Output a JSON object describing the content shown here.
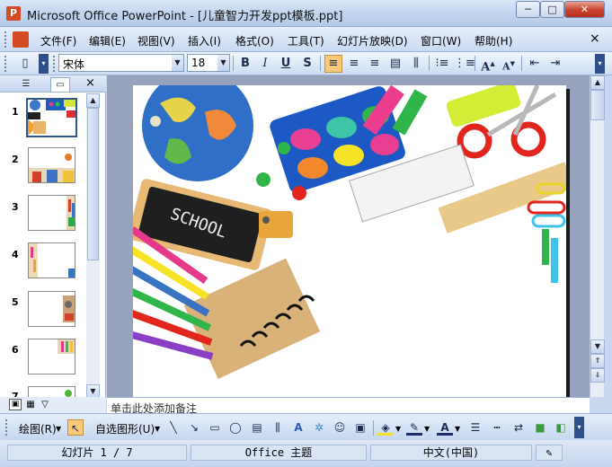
{
  "window": {
    "title": "Microsoft Office PowerPoint - [儿童智力开发ppt模板.ppt]",
    "app_icon_letter": "P",
    "buttons": {
      "minimize": "─",
      "maximize": "□",
      "close": "✕"
    }
  },
  "menu": {
    "items": [
      "文件(F)",
      "编辑(E)",
      "视图(V)",
      "插入(I)",
      "格式(O)",
      "工具(T)",
      "幻灯片放映(D)",
      "窗口(W)",
      "帮助(H)"
    ],
    "close_doc": "×"
  },
  "format_toolbar": {
    "font_name": "宋体",
    "font_size": "18",
    "bold": "B",
    "italic": "I",
    "underline": "U",
    "shadow": "S",
    "align_left_active": true
  },
  "outline_pane": {
    "tabs": [
      "outline-tab",
      "slides-tab"
    ],
    "close": "×",
    "slides": [
      {
        "number": "1",
        "selected": true
      },
      {
        "number": "2",
        "selected": false
      },
      {
        "number": "3",
        "selected": false
      },
      {
        "number": "4",
        "selected": false
      },
      {
        "number": "5",
        "selected": false
      },
      {
        "number": "6",
        "selected": false
      },
      {
        "number": "7",
        "selected": false
      }
    ]
  },
  "slide": {
    "chalkboard_text": "SCHOOL"
  },
  "notes": {
    "placeholder": "单击此处添加备注"
  },
  "draw_toolbar": {
    "draw_label": "绘图(R)",
    "autoshapes_label": "自选图形(U)"
  },
  "status": {
    "slide_position": "幻灯片 1 / 7",
    "design": "Office 主题",
    "language": "中文(中国)"
  },
  "colors": {
    "accent": "#31568c",
    "active_button": "#f9c97a"
  }
}
